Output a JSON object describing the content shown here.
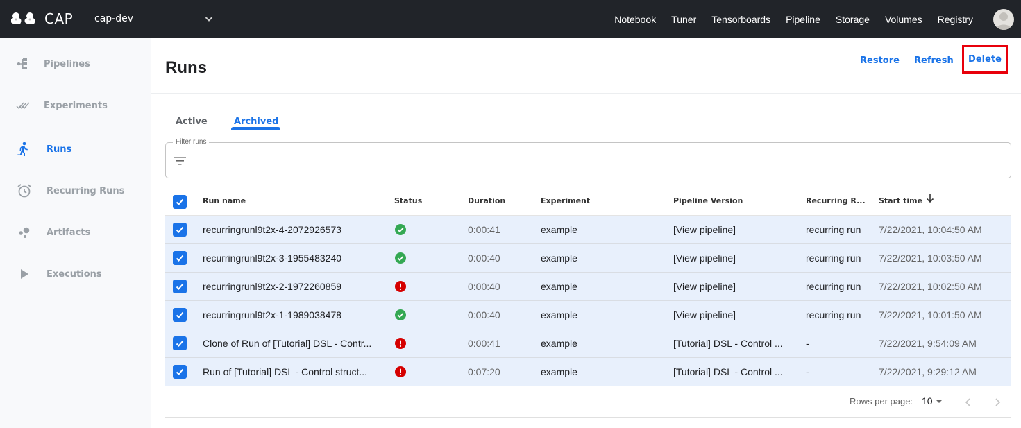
{
  "app": {
    "logo_text": "CAP",
    "namespace": "cap-dev"
  },
  "topnav": {
    "items": [
      {
        "label": "Notebook",
        "active": false
      },
      {
        "label": "Tuner",
        "active": false
      },
      {
        "label": "Tensorboards",
        "active": false
      },
      {
        "label": "Pipeline",
        "active": true
      },
      {
        "label": "Storage",
        "active": false
      },
      {
        "label": "Volumes",
        "active": false
      },
      {
        "label": "Registry",
        "active": false
      }
    ]
  },
  "sidebar": {
    "items": [
      {
        "label": "Pipelines",
        "icon": "pipelines-icon",
        "active": false
      },
      {
        "label": "Experiments",
        "icon": "experiments-icon",
        "active": false
      },
      {
        "label": "Runs",
        "icon": "runs-icon",
        "active": true
      },
      {
        "label": "Recurring Runs",
        "icon": "alarm-clock-icon",
        "active": false
      },
      {
        "label": "Artifacts",
        "icon": "artifacts-icon",
        "active": false
      },
      {
        "label": "Executions",
        "icon": "play-icon",
        "active": false
      }
    ]
  },
  "page": {
    "title": "Runs",
    "actions": {
      "restore": "Restore",
      "refresh": "Refresh",
      "delete": "Delete"
    },
    "tabs": [
      {
        "label": "Active",
        "active": false
      },
      {
        "label": "Archived",
        "active": true
      }
    ],
    "filter": {
      "label": "Filter runs",
      "value": "",
      "placeholder": ""
    }
  },
  "colors": {
    "accent": "#1a73e8",
    "success": "#34a853",
    "error": "#d50000",
    "highlight": "#e8000b"
  },
  "table": {
    "all_selected": true,
    "columns": [
      "Run name",
      "Status",
      "Duration",
      "Experiment",
      "Pipeline Version",
      "Recurring R...",
      "Start time"
    ],
    "sorted_by": "Start time",
    "sort_direction": "descending",
    "rows": [
      {
        "selected": true,
        "name": "recurringrunl9t2x-4-2072926573",
        "status": "succeeded",
        "duration": "0:00:41",
        "experiment": "example",
        "pipeline_version": "[View pipeline]",
        "recurring_run": "recurring run",
        "start_time": "7/22/2021, 10:04:50 AM"
      },
      {
        "selected": true,
        "name": "recurringrunl9t2x-3-1955483240",
        "status": "succeeded",
        "duration": "0:00:40",
        "experiment": "example",
        "pipeline_version": "[View pipeline]",
        "recurring_run": "recurring run",
        "start_time": "7/22/2021, 10:03:50 AM"
      },
      {
        "selected": true,
        "name": "recurringrunl9t2x-2-1972260859",
        "status": "failed",
        "duration": "0:00:40",
        "experiment": "example",
        "pipeline_version": "[View pipeline]",
        "recurring_run": "recurring run",
        "start_time": "7/22/2021, 10:02:50 AM"
      },
      {
        "selected": true,
        "name": "recurringrunl9t2x-1-1989038478",
        "status": "succeeded",
        "duration": "0:00:40",
        "experiment": "example",
        "pipeline_version": "[View pipeline]",
        "recurring_run": "recurring run",
        "start_time": "7/22/2021, 10:01:50 AM"
      },
      {
        "selected": true,
        "name": "Clone of Run of [Tutorial] DSL - Contr...",
        "status": "failed",
        "duration": "0:00:41",
        "experiment": "example",
        "pipeline_version": "[Tutorial] DSL - Control ...",
        "recurring_run": "-",
        "start_time": "7/22/2021, 9:54:09 AM"
      },
      {
        "selected": true,
        "name": "Run of [Tutorial] DSL - Control struct...",
        "status": "failed",
        "duration": "0:07:20",
        "experiment": "example",
        "pipeline_version": "[Tutorial] DSL - Control ...",
        "recurring_run": "-",
        "start_time": "7/22/2021, 9:29:12 AM"
      }
    ]
  },
  "pagination": {
    "rows_per_page_label": "Rows per page:",
    "rows_per_page": "10"
  }
}
